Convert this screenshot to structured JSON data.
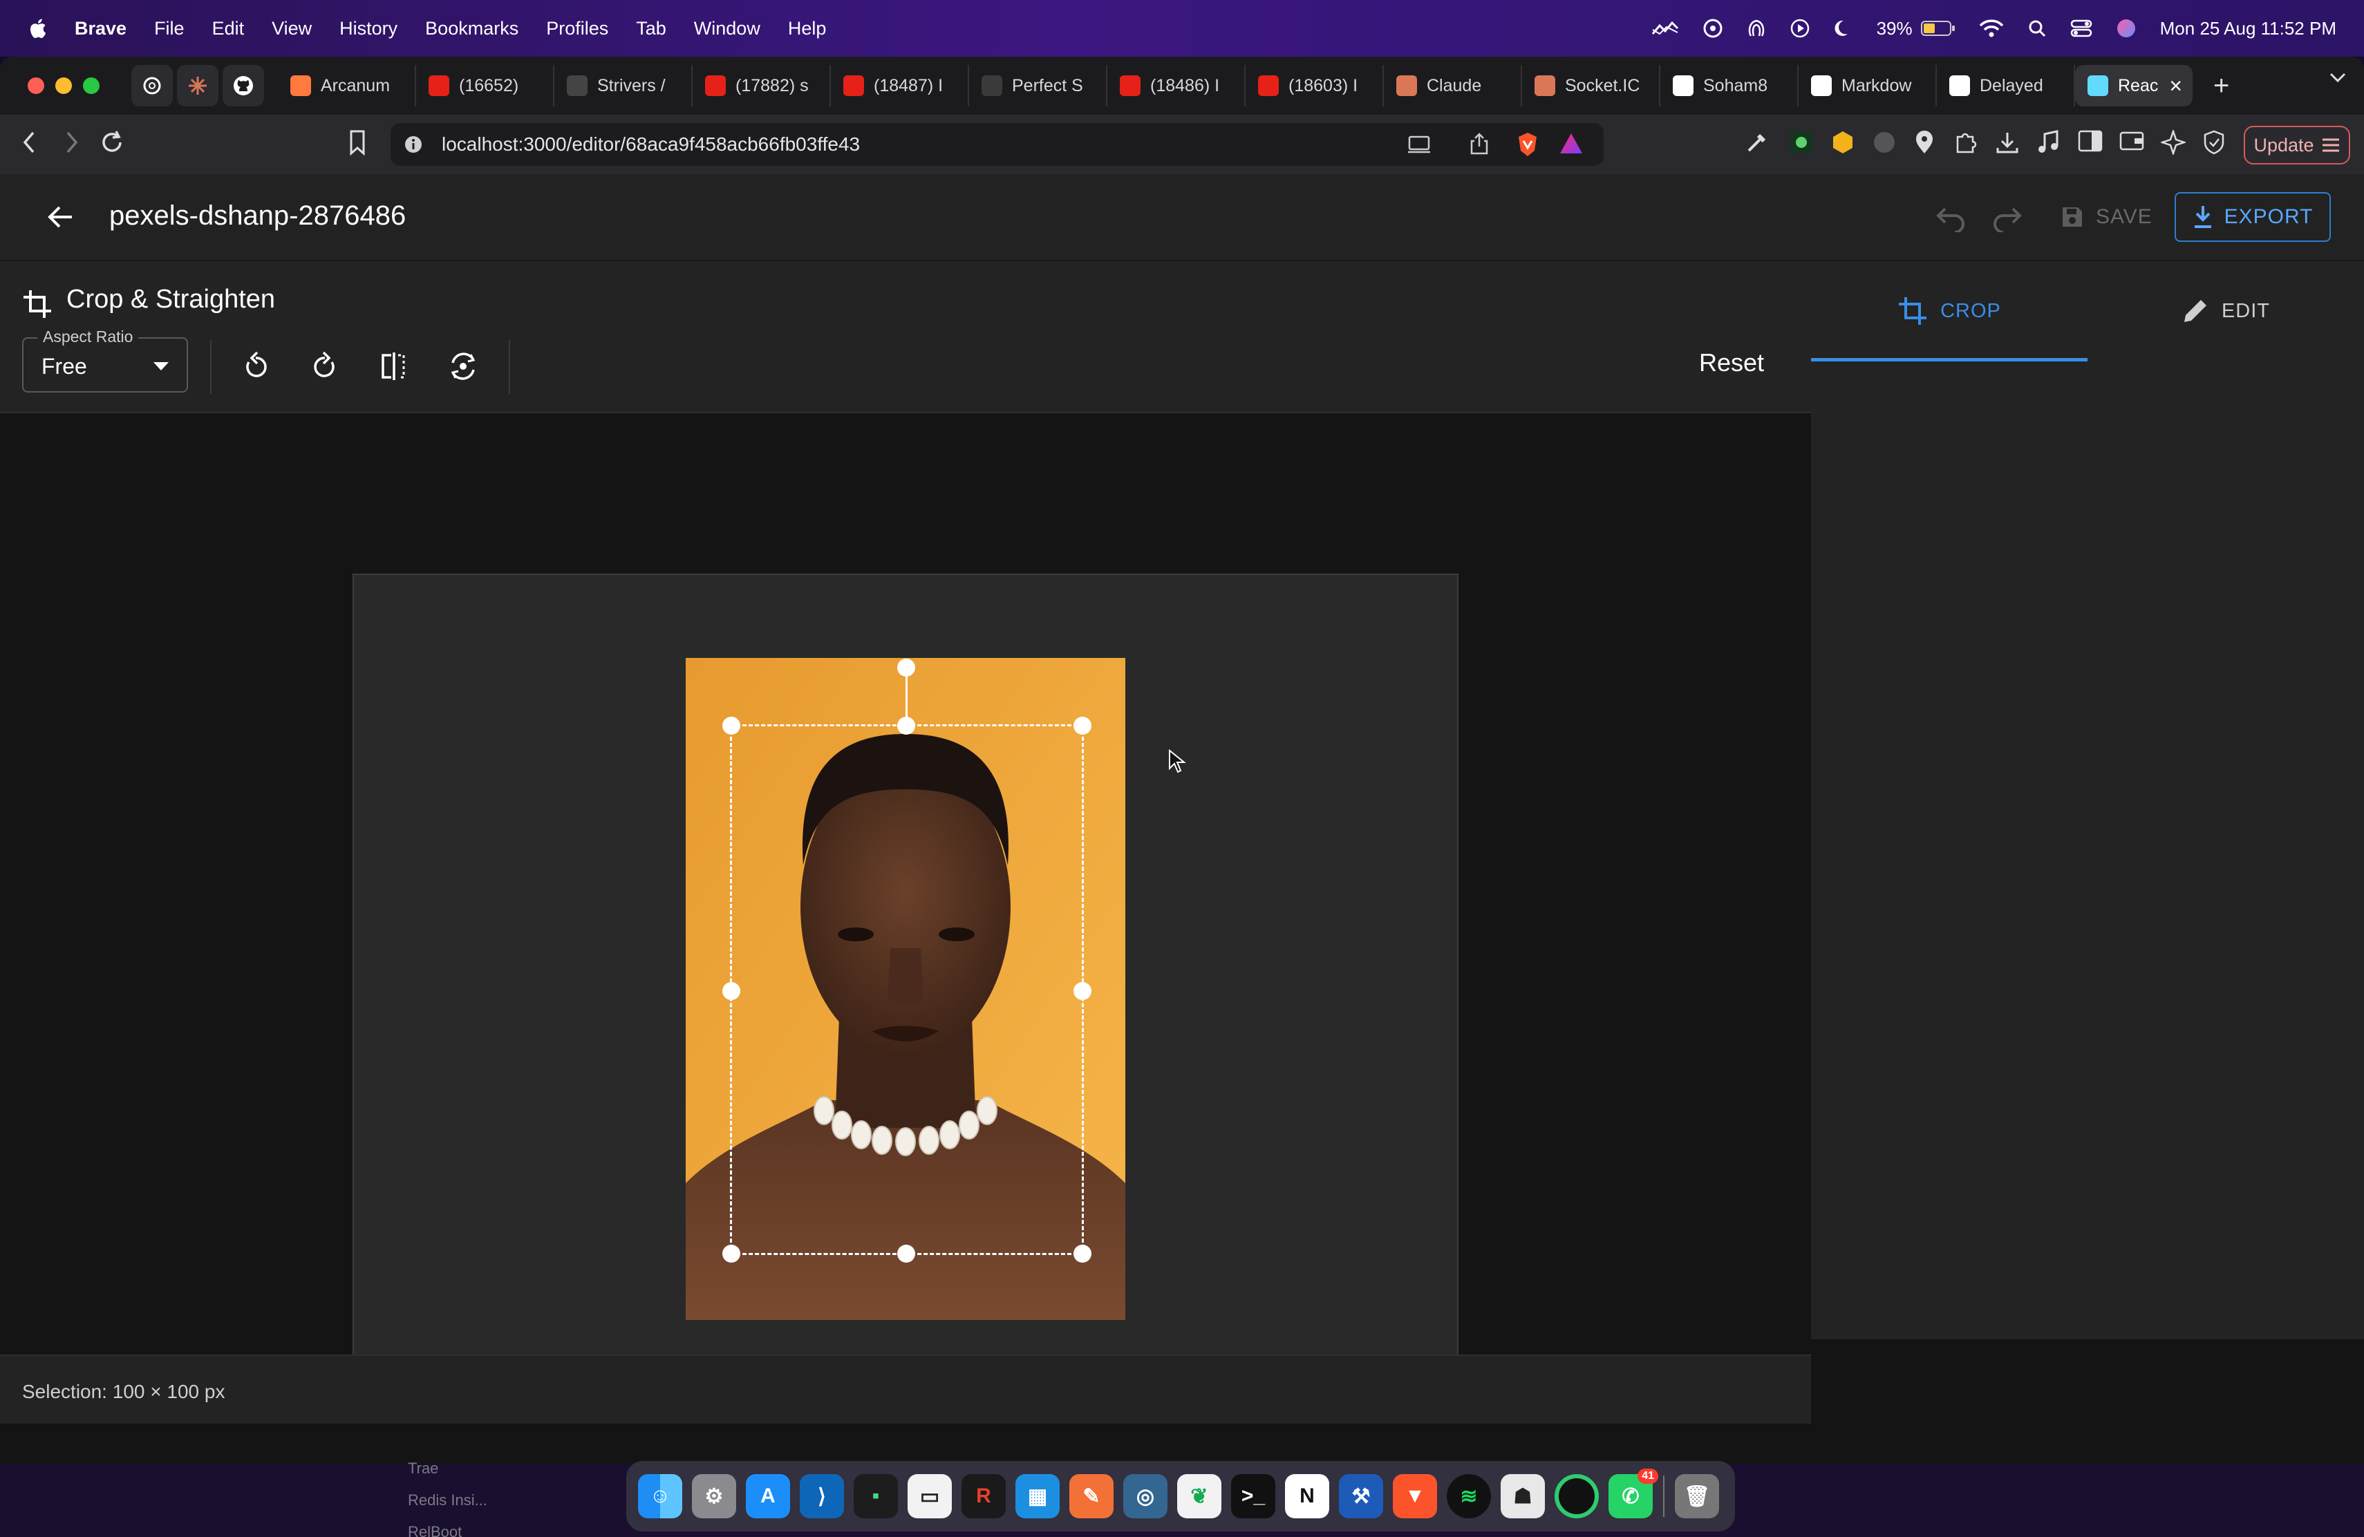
{
  "menubar": {
    "app": "Brave",
    "items": [
      "File",
      "Edit",
      "View",
      "History",
      "Bookmarks",
      "Profiles",
      "Tab",
      "Window",
      "Help"
    ],
    "battery": "39%",
    "datetime": "Mon 25 Aug  11:52 PM"
  },
  "tabs": [
    {
      "label": "Arcanum",
      "color": "#ff7a3c",
      "icon": "figma-icon"
    },
    {
      "label": "(16652)",
      "color": "#e62117",
      "icon": "youtube-icon"
    },
    {
      "label": "Strivers /",
      "color": "#444444",
      "icon": "tuf-icon"
    },
    {
      "label": "(17882) s",
      "color": "#e62117",
      "icon": "youtube-icon"
    },
    {
      "label": "(18487) I",
      "color": "#e62117",
      "icon": "youtube-icon"
    },
    {
      "label": "Perfect S",
      "color": "#3a3a3a",
      "icon": "gfg-icon"
    },
    {
      "label": "(18486) I",
      "color": "#e62117",
      "icon": "youtube-icon"
    },
    {
      "label": "(18603) I",
      "color": "#e62117",
      "icon": "youtube-icon"
    },
    {
      "label": "Claude",
      "color": "#d97757",
      "icon": "claude-icon"
    },
    {
      "label": "Socket.IC",
      "color": "#d97757",
      "icon": "claude-icon"
    },
    {
      "label": "Soham8",
      "color": "#ffffff",
      "icon": "github-icon"
    },
    {
      "label": "Markdow",
      "color": "#ffffff",
      "icon": "medium-icon"
    },
    {
      "label": "Delayed",
      "color": "#ffffff",
      "icon": "chatgpt-icon"
    },
    {
      "label": "Reac",
      "color": "#61dafb",
      "icon": "react-icon",
      "active": true
    }
  ],
  "browser": {
    "url": "localhost:3000/editor/68aca9f458acb66fb03ffe43",
    "update_label": "Update"
  },
  "editor": {
    "title": "pexels-dshanp-2876486",
    "save_label": "SAVE",
    "export_label": "EXPORT",
    "panel_title": "Crop & Straighten",
    "aspect_label": "Aspect Ratio",
    "aspect_value": "Free",
    "reset_label": "Reset",
    "selection_status": "Selection: 100 × 100 px",
    "side_tabs": [
      "CROP",
      "EDIT"
    ],
    "accent": "#3a8ee6"
  },
  "dock": {
    "sidebar_items": [
      "Trae",
      "Redis Insi...",
      "RelBoot"
    ],
    "whatsapp_badge": "41",
    "apps": [
      "finder-icon",
      "settings-icon",
      "appstore-icon",
      "vscode-icon",
      "terminal-green-icon",
      "notes-icon",
      "rapid-icon",
      "docker-icon",
      "postman-icon",
      "pgadmin-icon",
      "mongodb-icon",
      "terminal-icon",
      "notion-icon",
      "xcode-icon",
      "brave-icon",
      "spotify-icon",
      "alien-icon",
      "loader-icon",
      "whatsapp-icon",
      "trash-icon"
    ]
  }
}
